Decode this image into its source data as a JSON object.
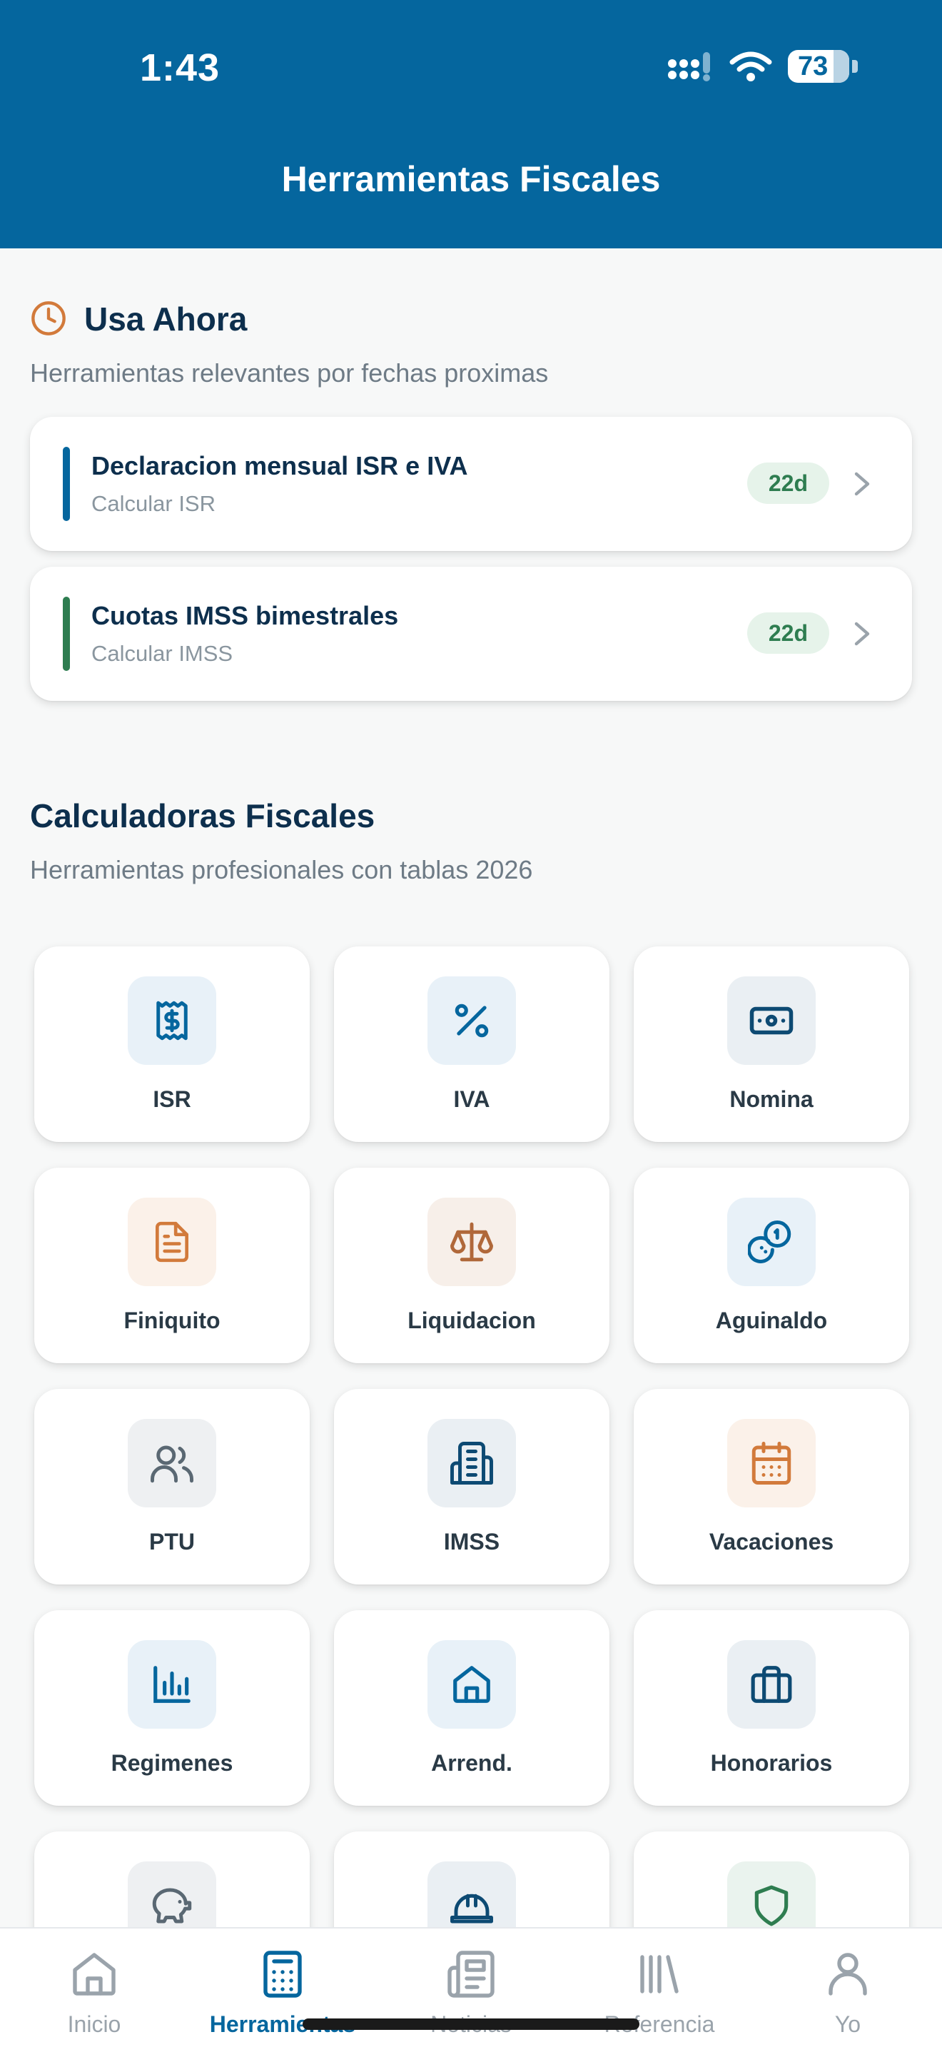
{
  "status_bar": {
    "time": "1:43",
    "battery": "73"
  },
  "header": {
    "title": "Herramientas Fiscales"
  },
  "usa_ahora": {
    "title": "Usa Ahora",
    "subtitle": "Herramientas relevantes por fechas proximas",
    "items": [
      {
        "title": "Declaracion mensual ISR e IVA",
        "subtitle": "Calcular ISR",
        "badge": "22d",
        "bar_color": "#05669e"
      },
      {
        "title": "Cuotas IMSS bimestrales",
        "subtitle": "Calcular IMSS",
        "badge": "22d",
        "bar_color": "#2e7d50"
      }
    ]
  },
  "calculadoras": {
    "title": "Calculadoras Fiscales",
    "subtitle": "Herramientas profesionales con tablas 2026",
    "tiles": [
      {
        "label": "ISR",
        "icon": "receipt-dollar-icon",
        "tone": "blue"
      },
      {
        "label": "IVA",
        "icon": "percent-icon",
        "tone": "blue"
      },
      {
        "label": "Nomina",
        "icon": "banknote-icon",
        "tone": "navy"
      },
      {
        "label": "Finiquito",
        "icon": "document-icon",
        "tone": "orange"
      },
      {
        "label": "Liquidacion",
        "icon": "scale-icon",
        "tone": "brown"
      },
      {
        "label": "Aguinaldo",
        "icon": "coins-icon",
        "tone": "blue"
      },
      {
        "label": "PTU",
        "icon": "users-icon",
        "tone": "gray"
      },
      {
        "label": "IMSS",
        "icon": "building-icon",
        "tone": "navy"
      },
      {
        "label": "Vacaciones",
        "icon": "calendar-icon",
        "tone": "orange"
      },
      {
        "label": "Regimenes",
        "icon": "bar-chart-icon",
        "tone": "blue"
      },
      {
        "label": "Arrend.",
        "icon": "home-icon",
        "tone": "blue"
      },
      {
        "label": "Honorarios",
        "icon": "briefcase-icon",
        "tone": "navy"
      },
      {
        "label": "",
        "icon": "piggy-bank-icon",
        "tone": "gray"
      },
      {
        "label": "",
        "icon": "hard-hat-icon",
        "tone": "navy"
      },
      {
        "label": "",
        "icon": "shield-icon",
        "tone": "green"
      }
    ]
  },
  "tabbar": {
    "items": [
      {
        "label": "Inicio",
        "icon": "home-icon",
        "active": false
      },
      {
        "label": "Herramientas",
        "icon": "calculator-icon",
        "active": true
      },
      {
        "label": "Noticias",
        "icon": "newspaper-icon",
        "active": false
      },
      {
        "label": "Referencia",
        "icon": "library-icon",
        "active": false
      },
      {
        "label": "Yo",
        "icon": "user-icon",
        "active": false
      }
    ]
  },
  "colors": {
    "header": "#05669e",
    "accent": "#05669e",
    "badge_bg": "#e6f3ea",
    "badge_text": "#2e7d50"
  }
}
